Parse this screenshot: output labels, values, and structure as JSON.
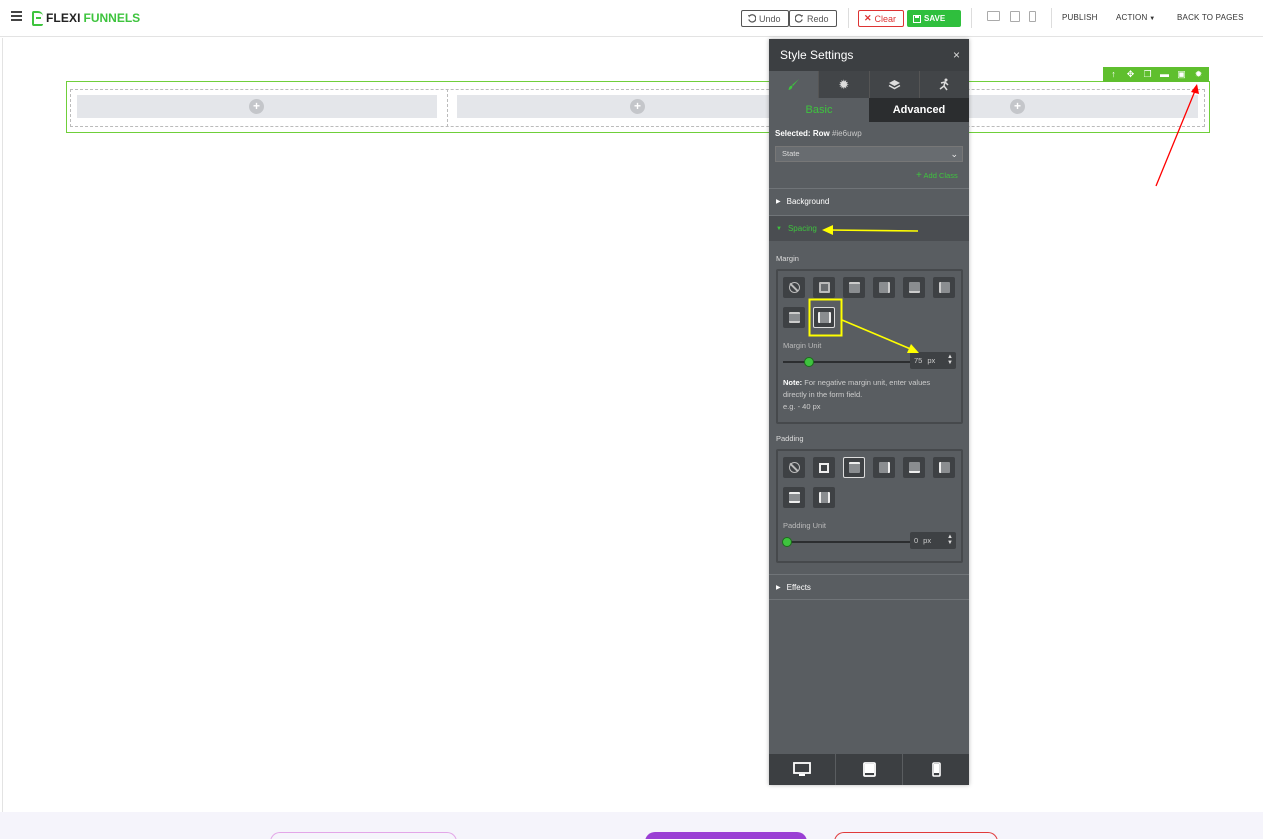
{
  "app": {
    "brand_part1": "FLEXI",
    "brand_part2": "FUNNELS"
  },
  "toolbar": {
    "undo_label": "Undo",
    "redo_label": "Redo",
    "clear_label": "Clear",
    "save_label": "SAVE",
    "publish_label": "PUBLISH",
    "action_label": "ACTION",
    "back_label": "BACK TO PAGES"
  },
  "row_toolbar": {
    "icons": [
      "arrow-up-icon",
      "move-icon",
      "copy-icon",
      "trash-icon",
      "save-icon",
      "gear-icon"
    ]
  },
  "canvas": {
    "add_symbol": "+"
  },
  "panel": {
    "title": "Style Settings",
    "close": "×",
    "tabs": [
      "brush-icon",
      "gear-icon",
      "layers-icon",
      "motion-icon"
    ],
    "subtabs": {
      "basic": "Basic",
      "advanced": "Advanced"
    },
    "selected_label": "Selected:",
    "selected_type": "Row",
    "selected_id": "#ie6uwp",
    "state_placeholder": "State",
    "add_class": "Add Class",
    "sections": {
      "background": "Background",
      "spacing": "Spacing",
      "effects": "Effects"
    },
    "margin": {
      "label": "Margin",
      "unit_label": "Margin Unit",
      "value": "75",
      "unit": "px",
      "note_bold": "Note:",
      "note_text": "For negative margin unit, enter values directly in the form field.",
      "note_example": "e.g. - 40 px"
    },
    "padding": {
      "label": "Padding",
      "unit_label": "Padding Unit",
      "value": "0",
      "unit": "px"
    },
    "footer": [
      "desktop-icon",
      "tablet-icon",
      "mobile-icon"
    ]
  },
  "colors": {
    "brand_green": "#3ec43e",
    "panel_bg": "#595d61",
    "annotation_red": "#ff0000",
    "annotation_yellow": "#ffff00"
  }
}
